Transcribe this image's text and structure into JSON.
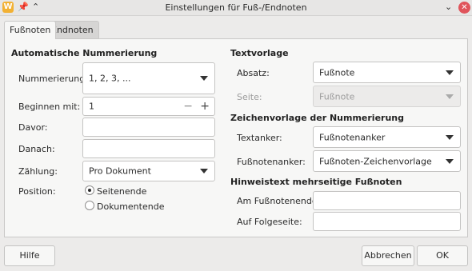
{
  "window": {
    "title": "Einstellungen für Fuß-/Endnoten",
    "app_icon_text": "W",
    "pin_glyph": "📌",
    "collapse_glyph": "⌃",
    "chevron_glyph": "⌄",
    "close_glyph": "✕"
  },
  "tabs": [
    {
      "label": "Fußnoten",
      "active": true
    },
    {
      "label": "Endnoten",
      "active": false
    }
  ],
  "auto_numbering": {
    "title": "Automatische Nummerierung",
    "numbering_label": "Nummerierung:",
    "numbering_value": "1, 2, 3, ...",
    "start_label": "Beginnen mit:",
    "start_value": "1",
    "minus_glyph": "−",
    "plus_glyph": "+",
    "before_label": "Davor:",
    "before_value": "",
    "after_label": "Danach:",
    "after_value": "",
    "count_label": "Zählung:",
    "count_value": "Pro Dokument",
    "position_label": "Position:",
    "position_options": [
      {
        "label": "Seitenende",
        "checked": true
      },
      {
        "label": "Dokumentende",
        "checked": false
      }
    ]
  },
  "text_template": {
    "title": "Textvorlage",
    "paragraph_label": "Absatz:",
    "paragraph_value": "Fußnote",
    "page_label": "Seite:",
    "page_value": "Fußnote"
  },
  "char_template": {
    "title": "Zeichenvorlage der Nummerierung",
    "text_anchor_label": "Textanker:",
    "text_anchor_value": "Fußnotenanker",
    "footnote_anchor_label": "Fußnotenanker:",
    "footnote_anchor_value": "Fußnoten-Zeichenvorlage"
  },
  "continuation": {
    "title": "Hinweistext mehrseitige Fußnoten",
    "end_label": "Am Fußnotenende:",
    "end_value": "",
    "next_label": "Auf Folgeseite:",
    "next_value": ""
  },
  "buttons": {
    "help": "Hilfe",
    "cancel": "Abbrechen",
    "ok": "OK"
  },
  "colors": {
    "close_button": "#e0545b",
    "app_icon": "#f2b134"
  }
}
